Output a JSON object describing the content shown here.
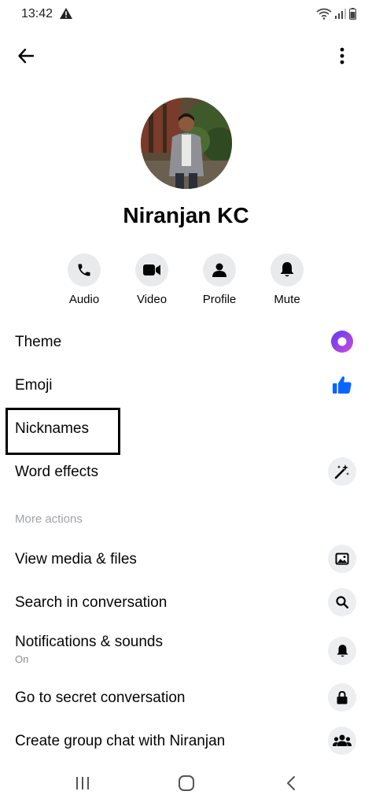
{
  "status": {
    "time": "13:42"
  },
  "contact": {
    "name": "Niranjan KC"
  },
  "actions": [
    {
      "label": "Audio",
      "icon": "phone-icon"
    },
    {
      "label": "Video",
      "icon": "video-icon"
    },
    {
      "label": "Profile",
      "icon": "person-icon"
    },
    {
      "label": "Mute",
      "icon": "bell-icon"
    }
  ],
  "settings": {
    "theme": "Theme",
    "emoji": "Emoji",
    "nicknames": "Nicknames",
    "word_effects": "Word effects"
  },
  "more_actions": {
    "header": "More actions",
    "view_media": "View media & files",
    "search": "Search in conversation",
    "notifications": "Notifications  & sounds",
    "notifications_sub": "On",
    "secret": "Go to secret conversation",
    "group": "Create group chat with Niranjan"
  },
  "colors": {
    "accent": "#0866ff",
    "theme_gradient_start": "#6b3bdc",
    "theme_gradient_end": "#c04ce6"
  }
}
